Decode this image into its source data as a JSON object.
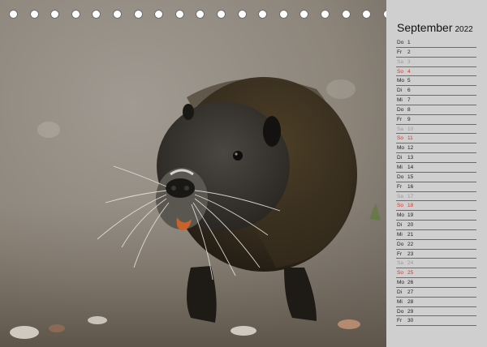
{
  "calendar": {
    "month": "September",
    "year": "2022",
    "days": [
      {
        "dow": "Do",
        "num": "1",
        "type": "wk"
      },
      {
        "dow": "Fr",
        "num": "2",
        "type": "wk"
      },
      {
        "dow": "Sa",
        "num": "3",
        "type": "sat"
      },
      {
        "dow": "So",
        "num": "4",
        "type": "sun"
      },
      {
        "dow": "Mo",
        "num": "5",
        "type": "wk"
      },
      {
        "dow": "Di",
        "num": "6",
        "type": "wk"
      },
      {
        "dow": "Mi",
        "num": "7",
        "type": "wk"
      },
      {
        "dow": "Do",
        "num": "8",
        "type": "wk"
      },
      {
        "dow": "Fr",
        "num": "9",
        "type": "wk"
      },
      {
        "dow": "Sa",
        "num": "10",
        "type": "sat"
      },
      {
        "dow": "So",
        "num": "11",
        "type": "sun"
      },
      {
        "dow": "Mo",
        "num": "12",
        "type": "wk"
      },
      {
        "dow": "Di",
        "num": "13",
        "type": "wk"
      },
      {
        "dow": "Mi",
        "num": "14",
        "type": "wk"
      },
      {
        "dow": "Do",
        "num": "15",
        "type": "wk"
      },
      {
        "dow": "Fr",
        "num": "16",
        "type": "wk"
      },
      {
        "dow": "Sa",
        "num": "17",
        "type": "sat"
      },
      {
        "dow": "So",
        "num": "18",
        "type": "sun"
      },
      {
        "dow": "Mo",
        "num": "19",
        "type": "wk"
      },
      {
        "dow": "Di",
        "num": "20",
        "type": "wk"
      },
      {
        "dow": "Mi",
        "num": "21",
        "type": "wk"
      },
      {
        "dow": "Do",
        "num": "22",
        "type": "wk"
      },
      {
        "dow": "Fr",
        "num": "23",
        "type": "wk"
      },
      {
        "dow": "Sa",
        "num": "24",
        "type": "sat"
      },
      {
        "dow": "So",
        "num": "25",
        "type": "sun"
      },
      {
        "dow": "Mo",
        "num": "26",
        "type": "wk"
      },
      {
        "dow": "Di",
        "num": "27",
        "type": "wk"
      },
      {
        "dow": "Mi",
        "num": "28",
        "type": "wk"
      },
      {
        "dow": "Do",
        "num": "29",
        "type": "wk"
      },
      {
        "dow": "Fr",
        "num": "30",
        "type": "wk"
      }
    ]
  },
  "colors": {
    "sunday": "#d0392b",
    "saturday": "#9a9a9a",
    "panel": "#cfcfcf"
  },
  "photo": {
    "subject": "nutria"
  }
}
